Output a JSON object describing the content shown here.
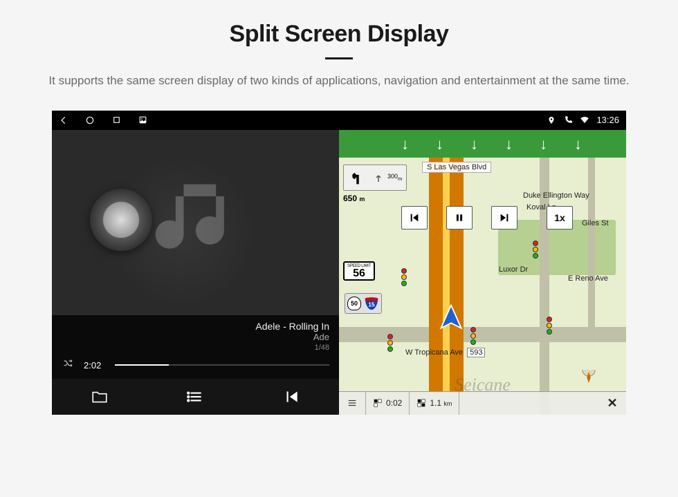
{
  "header": {
    "title": "Split Screen Display",
    "subtitle": "It supports the same screen display of two kinds of applications, navigation and entertainment at the same time."
  },
  "status_bar": {
    "clock": "13:26",
    "icons": [
      "back",
      "circle",
      "square",
      "image",
      "location",
      "phone",
      "wifi"
    ]
  },
  "music": {
    "track_title": "Adele - Rolling In",
    "artist": "Ade",
    "track_index": "1/48",
    "elapsed": "2:02",
    "controls": [
      "folder",
      "list",
      "prev"
    ]
  },
  "map": {
    "turn_hint_dist": "300",
    "turn_hint_unit": "m",
    "approach_dist": "650",
    "approach_unit": "m",
    "speed_limit_label": "SPEED LIMIT",
    "speed_limit_value": "56",
    "us_route": "50",
    "interstate": "15",
    "playback_speed": "1x",
    "streets": {
      "top": "S Las Vegas Blvd",
      "duke": "Duke Ellington Way",
      "koval": "Koval Ln",
      "luxor": "Luxor Dr",
      "reno": "E Reno Ave",
      "giles": "Giles St",
      "bottom": "W Tropicana Ave",
      "bottom_num": "593"
    },
    "bottom": {
      "time": "0:02",
      "dist_val": "1.1",
      "dist_unit": "km"
    },
    "watermark": "Seicane"
  }
}
